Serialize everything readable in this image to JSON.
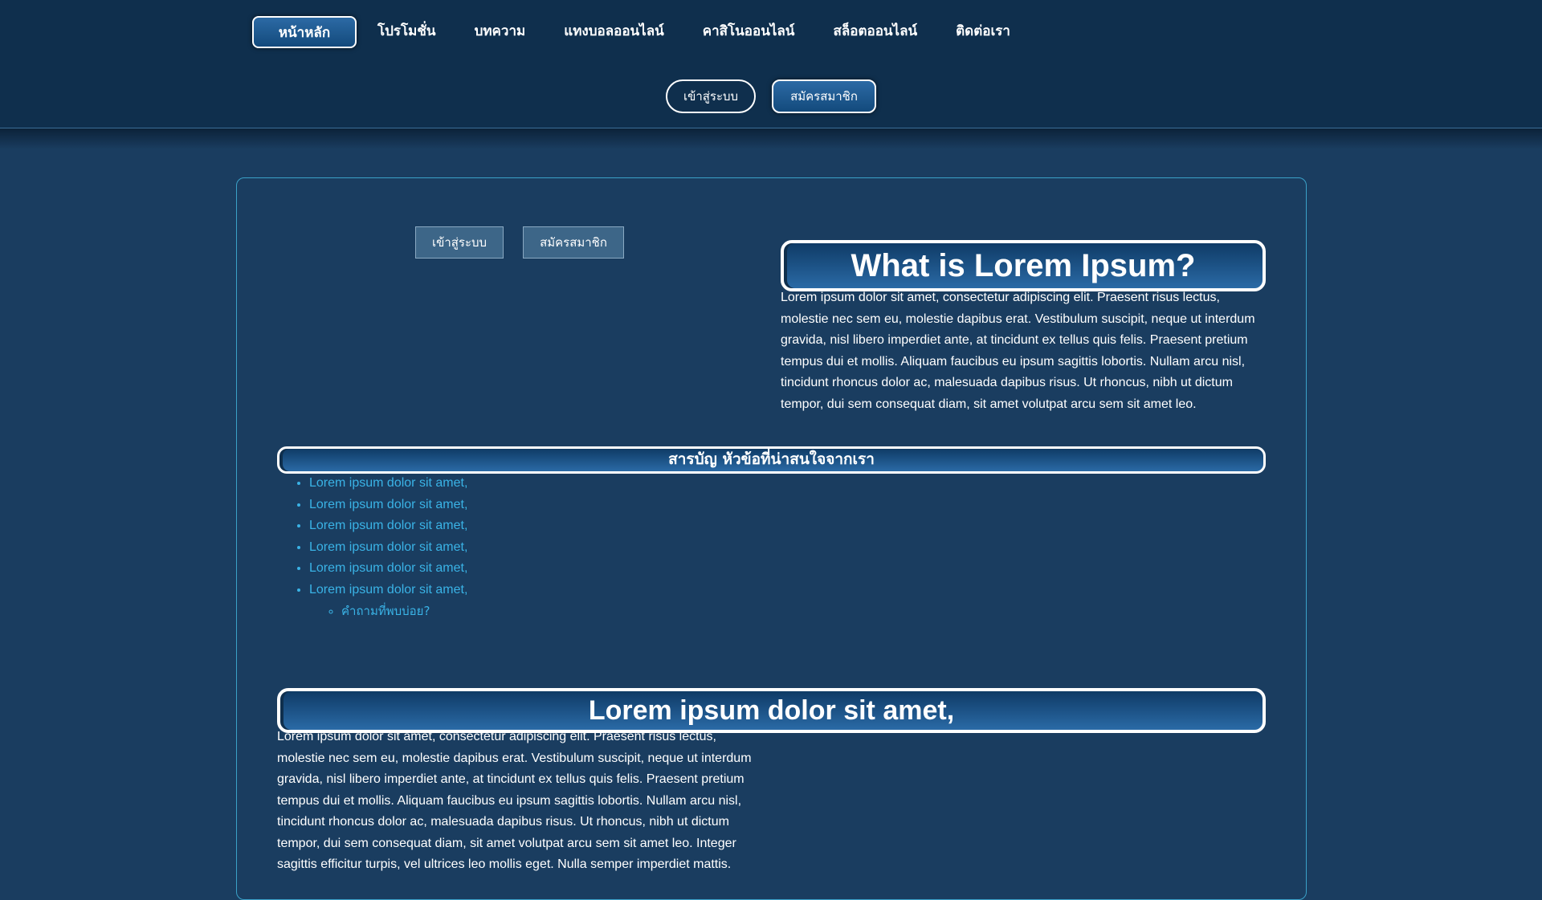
{
  "header": {
    "nav": [
      {
        "label": "หน้าหลัก",
        "active": true
      },
      {
        "label": "โปรโมชั่น",
        "active": false
      },
      {
        "label": "บทความ",
        "active": false
      },
      {
        "label": "แทงบอลออนไลน์",
        "active": false
      },
      {
        "label": "คาสิโนออนไลน์",
        "active": false
      },
      {
        "label": "สล็อตออนไลน์",
        "active": false
      },
      {
        "label": "ติดต่อเรา",
        "active": false
      }
    ],
    "login_label": "เข้าสู่ระบบ",
    "register_label": "สมัครสมาชิก"
  },
  "content": {
    "login_label": "เข้าสู่ระบบ",
    "register_label": "สมัครสมาชิก",
    "main_heading": "What is Lorem Ipsum?",
    "intro_text": "Lorem ipsum dolor sit amet, consectetur adipiscing elit. Praesent risus lectus, molestie nec sem eu, molestie dapibus erat. Vestibulum suscipit, neque ut interdum gravida, nisl libero imperdiet ante, at tincidunt ex tellus quis felis. Praesent pretium tempus dui et mollis. Aliquam faucibus eu ipsum sagittis lobortis. Nullam arcu nisl, tincidunt rhoncus dolor ac, malesuada dapibus risus. Ut rhoncus, nibh ut dictum tempor, dui sem consequat diam, sit amet volutpat arcu sem sit amet leo.",
    "toc_heading": "สารบัญ หัวข้อที่น่าสนใจจากเรา",
    "toc_items": [
      "Lorem ipsum dolor sit amet,",
      "Lorem ipsum dolor sit amet,",
      "Lorem ipsum dolor sit amet,",
      "Lorem ipsum dolor sit amet,",
      "Lorem ipsum dolor sit amet,",
      "Lorem ipsum dolor sit amet,"
    ],
    "toc_subitem": "คำถามที่พบบ่อย?",
    "second_heading": "Lorem ipsum dolor sit amet,",
    "body_text": "Lorem ipsum dolor sit amet, consectetur adipiscing elit. Praesent risus lectus, molestie nec sem eu, molestie dapibus erat. Vestibulum suscipit, neque ut interdum gravida, nisl libero imperdiet ante, at tincidunt ex tellus quis felis. Praesent pretium tempus dui et mollis. Aliquam faucibus eu ipsum sagittis lobortis. Nullam arcu nisl, tincidunt rhoncus dolor ac, malesuada dapibus risus. Ut rhoncus, nibh ut dictum tempor, dui sem consequat diam, sit amet volutpat arcu sem sit amet leo. Integer sagittis efficitur turpis, vel ultrices leo mollis eget. Nulla semper imperdiet mattis."
  },
  "colors": {
    "background": "#1a3d60",
    "header": "#0f2f4d",
    "link": "#3ab3e6",
    "panel_border": "#3aa1c8"
  }
}
